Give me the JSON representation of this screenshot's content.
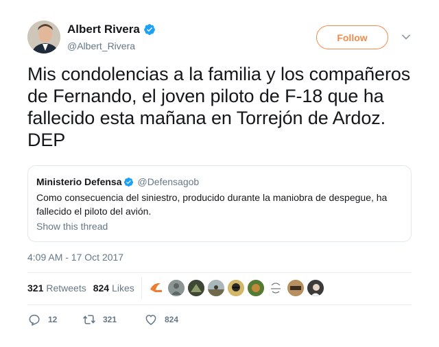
{
  "author": {
    "name": "Albert Rivera",
    "handle": "@Albert_Rivera",
    "verified": true
  },
  "follow_label": "Follow",
  "tweet_text": "Mis condolencias a la familia y los compañeros de Fernando, el joven piloto de F-18 que ha fallecido esta mañana en Torrejón de Ardoz. DEP",
  "quoted": {
    "name": "Ministerio Defensa",
    "handle": "@Defensagob",
    "verified": true,
    "text": "Como consecuencia del siniestro, producido durante la maniobra de despegue, ha fallecido el piloto del avión.",
    "show_thread": "Show this thread"
  },
  "timestamp": "4:09 AM - 17 Oct 2017",
  "stats": {
    "retweets_count": "321",
    "retweets_label": "Retweets",
    "likes_count": "824",
    "likes_label": "Likes"
  },
  "actions": {
    "replies": "12",
    "retweets": "321",
    "likes": "824"
  },
  "colors": {
    "accent": "#f48a4a",
    "verified": "#1da1f2",
    "muted": "#657786",
    "text": "#14171a"
  },
  "icons": {
    "verified": "verified-badge-icon",
    "caret": "chevron-down-icon",
    "reply": "reply-icon",
    "retweet": "retweet-icon",
    "like": "heart-icon"
  }
}
